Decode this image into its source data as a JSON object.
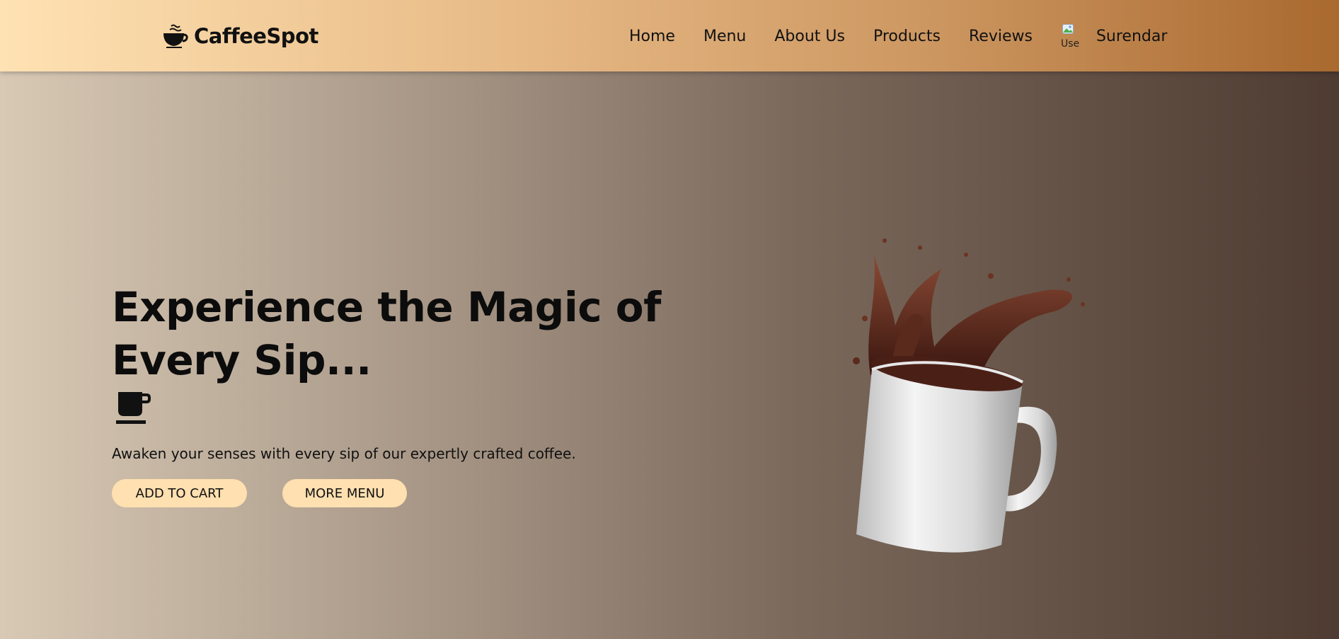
{
  "brand": {
    "name": "CaffeeSpot",
    "icon": "coffee-cup-icon"
  },
  "nav": {
    "items": [
      {
        "label": "Home"
      },
      {
        "label": "Menu"
      },
      {
        "label": "About Us"
      },
      {
        "label": "Products"
      },
      {
        "label": "Reviews"
      }
    ],
    "user": {
      "name": "Surendar",
      "avatar_alt": "Use"
    }
  },
  "hero": {
    "title": "Experience the Magic of Every Sip...",
    "icon": "mug-icon",
    "subtitle": "Awaken your senses with every sip of our expertly crafted coffee.",
    "add_to_cart_label": "ADD TO CART",
    "more_menu_label": "MORE MENU",
    "image": "coffee-splash-mug"
  },
  "colors": {
    "button_bg": "#ffe0b0",
    "header_start": "#ffe2b3",
    "header_end": "#a9692f",
    "bg_start": "#d8c9b5",
    "bg_end": "#4e3b31"
  }
}
